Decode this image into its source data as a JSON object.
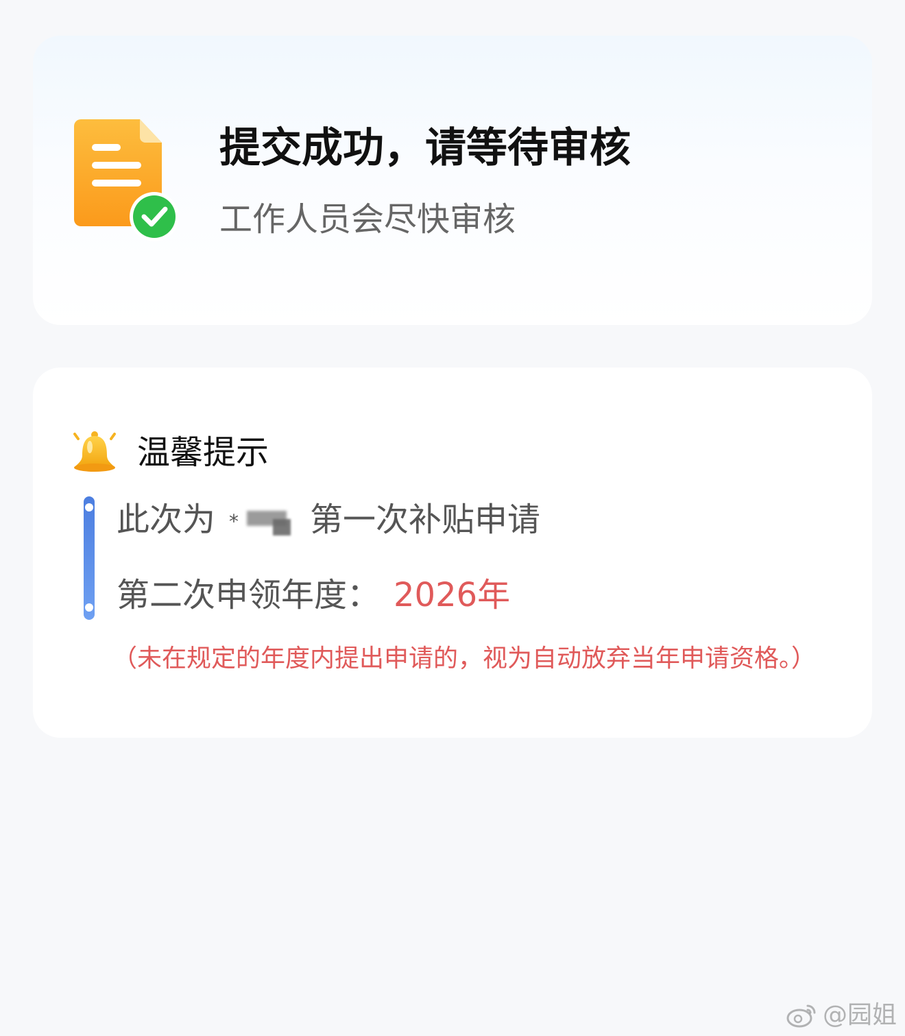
{
  "success_card": {
    "title": "提交成功，请等待审核",
    "subtitle": "工作人员会尽快审核",
    "icon": "document-check-icon"
  },
  "tips_card": {
    "title": "温馨提示",
    "icon": "bell-icon",
    "line1_prefix": "此次为",
    "line1_suffix": "第一次补贴申请",
    "line2_label": "第二次申领年度：",
    "line2_value": "2026年",
    "notice": "（未在规定的年度内提出申请的，视为自动放弃当年申请资格。）"
  },
  "watermark": {
    "text": "@园姐",
    "icon": "weibo-icon"
  },
  "colors": {
    "background": "#f7f8fa",
    "accent_red": "#e05a5a",
    "timeline_blue": "#4c7ee0",
    "doc_orange": "#fba321",
    "check_green": "#2fbf4a"
  }
}
